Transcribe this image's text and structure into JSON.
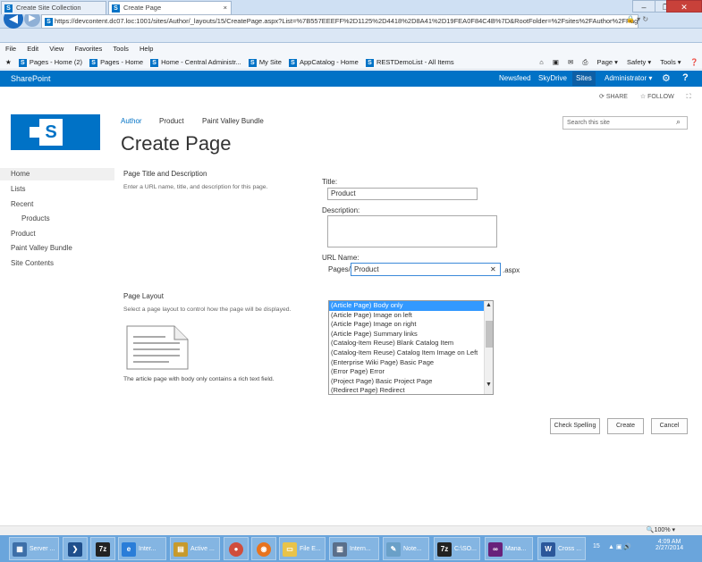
{
  "browser": {
    "address": "https://devcontent.dc07.loc:1001/sites/Author/_layouts/15/CreatePage.aspx?List=%7B557EEEFF%2D1125%2D4418%2D8A41%2D19FEA0F84C4B%7D&RootFolder=%2Fsites%2FAuthor%2FPages&Cr",
    "tabs": [
      {
        "label": "Create Site Collection"
      },
      {
        "label": "Create Page"
      }
    ],
    "tab_close": "×",
    "menu": [
      "File",
      "Edit",
      "View",
      "Favorites",
      "Tools",
      "Help"
    ],
    "favorites": [
      "Pages - Home (2)",
      "Pages - Home",
      "Home - Central Administr...",
      "My Site",
      "AppCatalog - Home",
      "RESTDemoList - All Items"
    ],
    "commands": [
      "Page ▾",
      "Safety ▾",
      "Tools ▾"
    ],
    "window_buttons": {
      "minimize": "–",
      "maximize": "❐",
      "close": "✕"
    }
  },
  "suite": {
    "brand": "SharePoint",
    "links": [
      "Newsfeed",
      "SkyDrive",
      "Sites"
    ],
    "user": "Administrator ▾",
    "share": "SHARE",
    "follow": "FOLLOW"
  },
  "site": {
    "logo_letter": "S",
    "breadcrumb": [
      "Author",
      "Product",
      "Paint Valley Bundle"
    ],
    "title": "Create Page",
    "search_placeholder": "Search this site"
  },
  "nav": {
    "items": [
      "Home",
      "Lists",
      "Recent",
      "Products",
      "Product",
      "Paint Valley Bundle",
      "Site Contents"
    ]
  },
  "form": {
    "section1_title": "Page Title and Description",
    "section1_desc": "Enter a URL name, title, and description for this page.",
    "title_label": "Title:",
    "title_value": "Product",
    "description_label": "Description:",
    "description_value": "",
    "url_label": "URL Name:",
    "url_prefix": "Pages/",
    "url_value": "Product",
    "url_suffix": ".aspx",
    "section2_title": "Page Layout",
    "section2_desc": "Select a page layout to control how the page will be displayed.",
    "preview_caption": "The article page with body only contains a rich text field.",
    "layouts": [
      "(Article Page) Body only",
      "(Article Page) Image on left",
      "(Article Page) Image on right",
      "(Article Page) Summary links",
      "(Catalog-Item Reuse) Blank Catalog Item",
      "(Catalog-Item Reuse) Catalog Item Image on Left",
      "(Enterprise Wiki Page) Basic Page",
      "(Error Page) Error",
      "(Project Page) Basic Project Page",
      "(Redirect Page) Redirect"
    ],
    "selected_layout": "(Article Page) Body only",
    "buttons": {
      "check": "Check Spelling",
      "create": "Create",
      "cancel": "Cancel"
    }
  },
  "status": {
    "zoom": "🔍100% ▾"
  },
  "taskbar": {
    "items": [
      "Server ...",
      "",
      "",
      "Inter...",
      "Active ...",
      "",
      "",
      "File E...",
      "Intern...",
      "Note...",
      "C:\\SO...",
      "Mana...",
      "Cross ..."
    ],
    "tray_number": "15",
    "time": "4:09 AM",
    "date": "2/27/2014"
  }
}
